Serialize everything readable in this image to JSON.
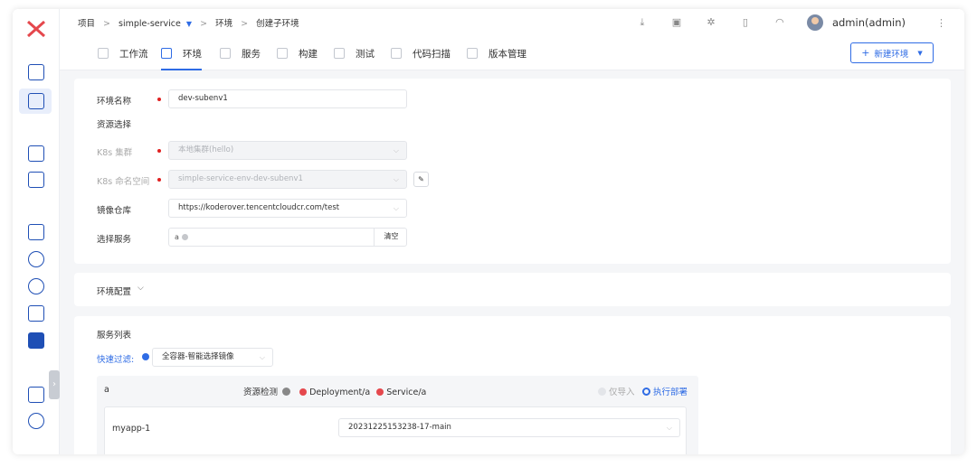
{
  "breadcrumb": {
    "project": "项目",
    "service": "simple-service",
    "env": "环境",
    "current": "创建子环境"
  },
  "user": {
    "name": "admin(admin)"
  },
  "tabs": [
    {
      "label": "工作流"
    },
    {
      "label": "环境"
    },
    {
      "label": "服务"
    },
    {
      "label": "构建"
    },
    {
      "label": "测试"
    },
    {
      "label": "代码扫描"
    },
    {
      "label": "版本管理"
    }
  ],
  "new_env_button": "新建环境",
  "form": {
    "env_name_label": "环境名称",
    "env_name_value": "dev-subenv1",
    "resource_section": "资源选择",
    "cluster_label": "K8s 集群",
    "cluster_value": "本地集群(hello)",
    "namespace_label": "K8s 命名空间",
    "namespace_value": "simple-service-env-dev-subenv1",
    "registry_label": "镜像仓库",
    "registry_value": "https://koderover.tencentcloudcr.com/test",
    "services_label": "选择服务",
    "services_tag": "a",
    "clear_button": "清空"
  },
  "env_config": {
    "label": "环境配置"
  },
  "service_list": {
    "title": "服务列表",
    "filter_label": "快速过滤:",
    "filter_value": "全容器-智能选择镜像",
    "service_name": "a",
    "resource_check_label": "资源检测",
    "resources": [
      "Deployment/a",
      "Service/a"
    ],
    "import_only_label": "仅导入",
    "deploy_label": "执行部署",
    "container_name": "myapp-1",
    "image_value": "20231225153238-17-main"
  },
  "colors": {
    "accent": "#2f6ce5",
    "required": "#e02020",
    "error": "#e5484d",
    "logo": "#e5484d"
  }
}
